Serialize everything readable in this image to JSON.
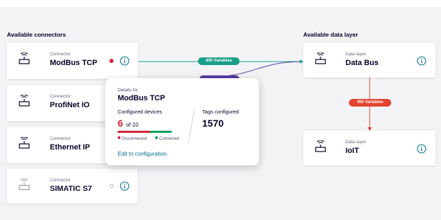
{
  "sections": {
    "connectors_title": "Available connectors",
    "data_layer_title": "Available data layer"
  },
  "connectors": [
    {
      "sub": "Connector",
      "name": "ModBus TCP",
      "status": "disconnected"
    },
    {
      "sub": "Connector",
      "name": "ProfiNet IO",
      "status": ""
    },
    {
      "sub": "Connector",
      "name": "Ethernet IP",
      "status": ""
    },
    {
      "sub": "Connector",
      "name": "SIMATIC S7",
      "status": "inactive"
    }
  ],
  "data_layers": [
    {
      "sub": "Data layer",
      "name": "Data Bus"
    },
    {
      "sub": "Data layer",
      "name": "IoIT"
    }
  ],
  "links": {
    "modbus_to_databus": "400 Variables",
    "databus_to_ioit": "450 Variables"
  },
  "popover": {
    "sub": "Details for",
    "title": "ModBus TCP",
    "devices_label": "Configured devices",
    "devices_count": "6",
    "devices_of": "of 10",
    "disconnected_label": "Disconnected",
    "connected_label": "Connected",
    "disconnected_fraction": 0.6,
    "tags_label": "Tags configured",
    "tags_value": "1570",
    "link": "Edit to configuration"
  },
  "colors": {
    "disconnected": "#d72339",
    "connected": "#00a05a",
    "link_green": "#199f8b",
    "link_red": "#e2442f",
    "link_purple": "#553ba3"
  },
  "icons": {
    "connector": "antenna-device-icon",
    "info": "info-circle-icon",
    "status": "status-dot-icon"
  }
}
